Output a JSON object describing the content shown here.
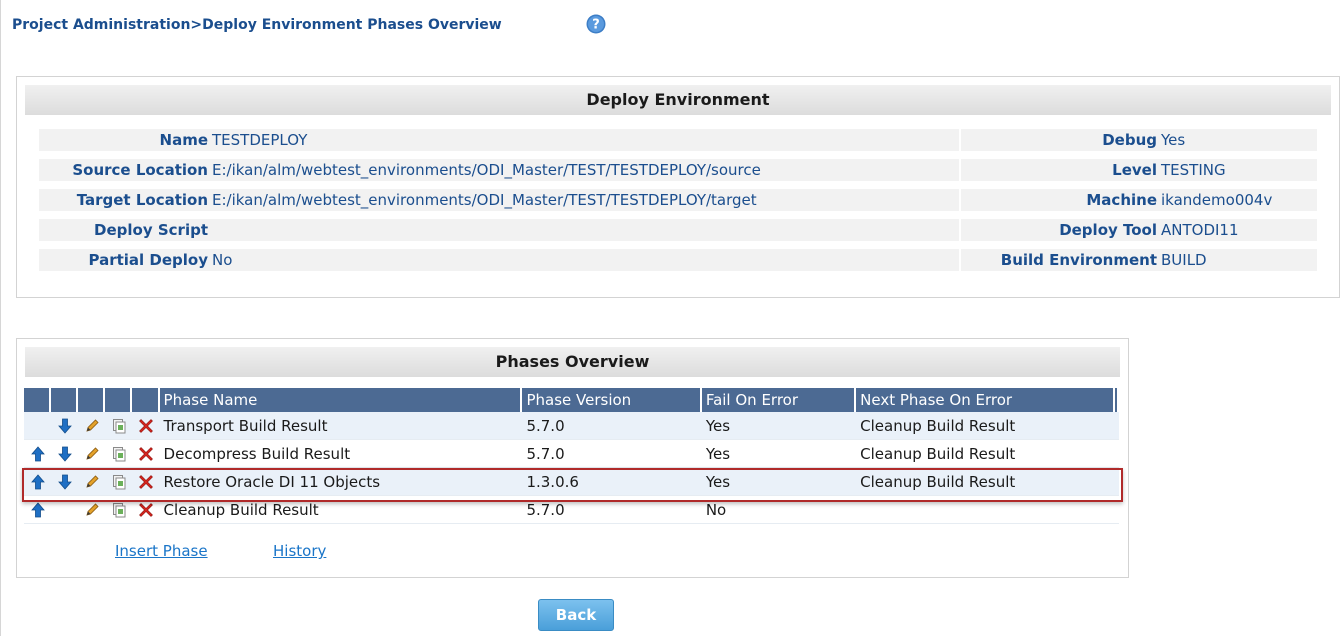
{
  "breadcrumb": "Project Administration>Deploy Environment Phases Overview",
  "deploy_environment": {
    "title": "Deploy Environment",
    "left_fields": [
      {
        "label": "Name",
        "value": "TESTDEPLOY"
      },
      {
        "label": "Source Location",
        "value": "E:/ikan/alm/webtest_environments/ODI_Master/TEST/TESTDEPLOY/source"
      },
      {
        "label": "Target Location",
        "value": "E:/ikan/alm/webtest_environments/ODI_Master/TEST/TESTDEPLOY/target"
      },
      {
        "label": "Deploy Script",
        "value": ""
      },
      {
        "label": "Partial Deploy",
        "value": "No"
      }
    ],
    "right_fields": [
      {
        "label": "Debug",
        "value": "Yes"
      },
      {
        "label": "Level",
        "value": "TESTING"
      },
      {
        "label": "Machine",
        "value": "ikandemo004v"
      },
      {
        "label": "Deploy Tool",
        "value": "ANTODI11"
      },
      {
        "label": "Build Environment",
        "value": "BUILD"
      }
    ]
  },
  "phases": {
    "title": "Phases Overview",
    "columns": [
      "Phase Name",
      "Phase Version",
      "Fail On Error",
      "Next Phase On Error"
    ],
    "rows": [
      {
        "name": "Transport Build Result",
        "version": "5.7.0",
        "fail_on_error": "Yes",
        "next_phase": "Cleanup Build Result",
        "up": false,
        "down": true
      },
      {
        "name": "Decompress Build Result",
        "version": "5.7.0",
        "fail_on_error": "Yes",
        "next_phase": "Cleanup Build Result",
        "up": true,
        "down": true
      },
      {
        "name": "Restore Oracle DI 11 Objects",
        "version": "1.3.0.6",
        "fail_on_error": "Yes",
        "next_phase": "Cleanup Build Result",
        "up": true,
        "down": true
      },
      {
        "name": "Cleanup Build Result",
        "version": "5.7.0",
        "fail_on_error": "No",
        "next_phase": "",
        "up": true,
        "down": false
      }
    ],
    "selected_row": 2
  },
  "links": {
    "insert_phase": "Insert Phase",
    "history": "History"
  },
  "back_button": "Back",
  "colors": {
    "accent": "#1b4e8e",
    "header_bg": "#4c6a93",
    "selection": "#b02a2a",
    "button": "#4a9fd9"
  }
}
